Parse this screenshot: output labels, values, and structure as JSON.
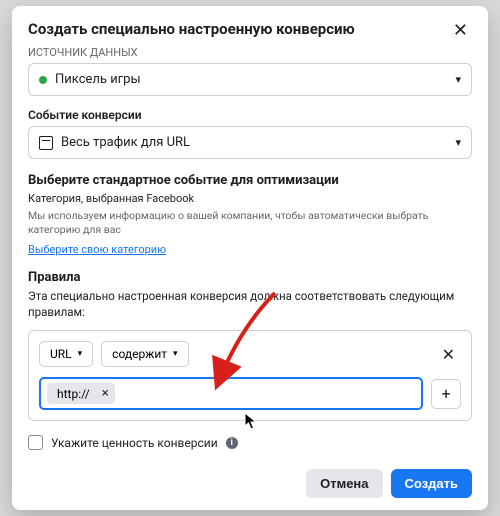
{
  "modal": {
    "title": "Создать специально настроенную конверсию",
    "source_label_cut": "ИСТОЧНИК ДАННЫХ",
    "pixel_name": "Пиксель игры",
    "conversion_event_label": "Событие конверсии",
    "conversion_event_value": "Весь трафик для URL",
    "optimize": {
      "heading": "Выберите стандартное событие для оптимизации",
      "sub": "Категория, выбранная Facebook",
      "helper": "Мы используем информацию о вашей компании, чтобы автоматически выбрать категорию для вас",
      "link": "Выберите свою категорию"
    },
    "rules": {
      "heading": "Правила",
      "desc": "Эта специально настроенная конверсия должна соответствовать следующим правилам:",
      "field_select": "URL",
      "match_select": "содержит",
      "token": "http://",
      "input_value": ""
    },
    "value_checkbox_label": "Укажите ценность конверсии",
    "footer": {
      "cancel": "Отмена",
      "create": "Создать"
    }
  }
}
